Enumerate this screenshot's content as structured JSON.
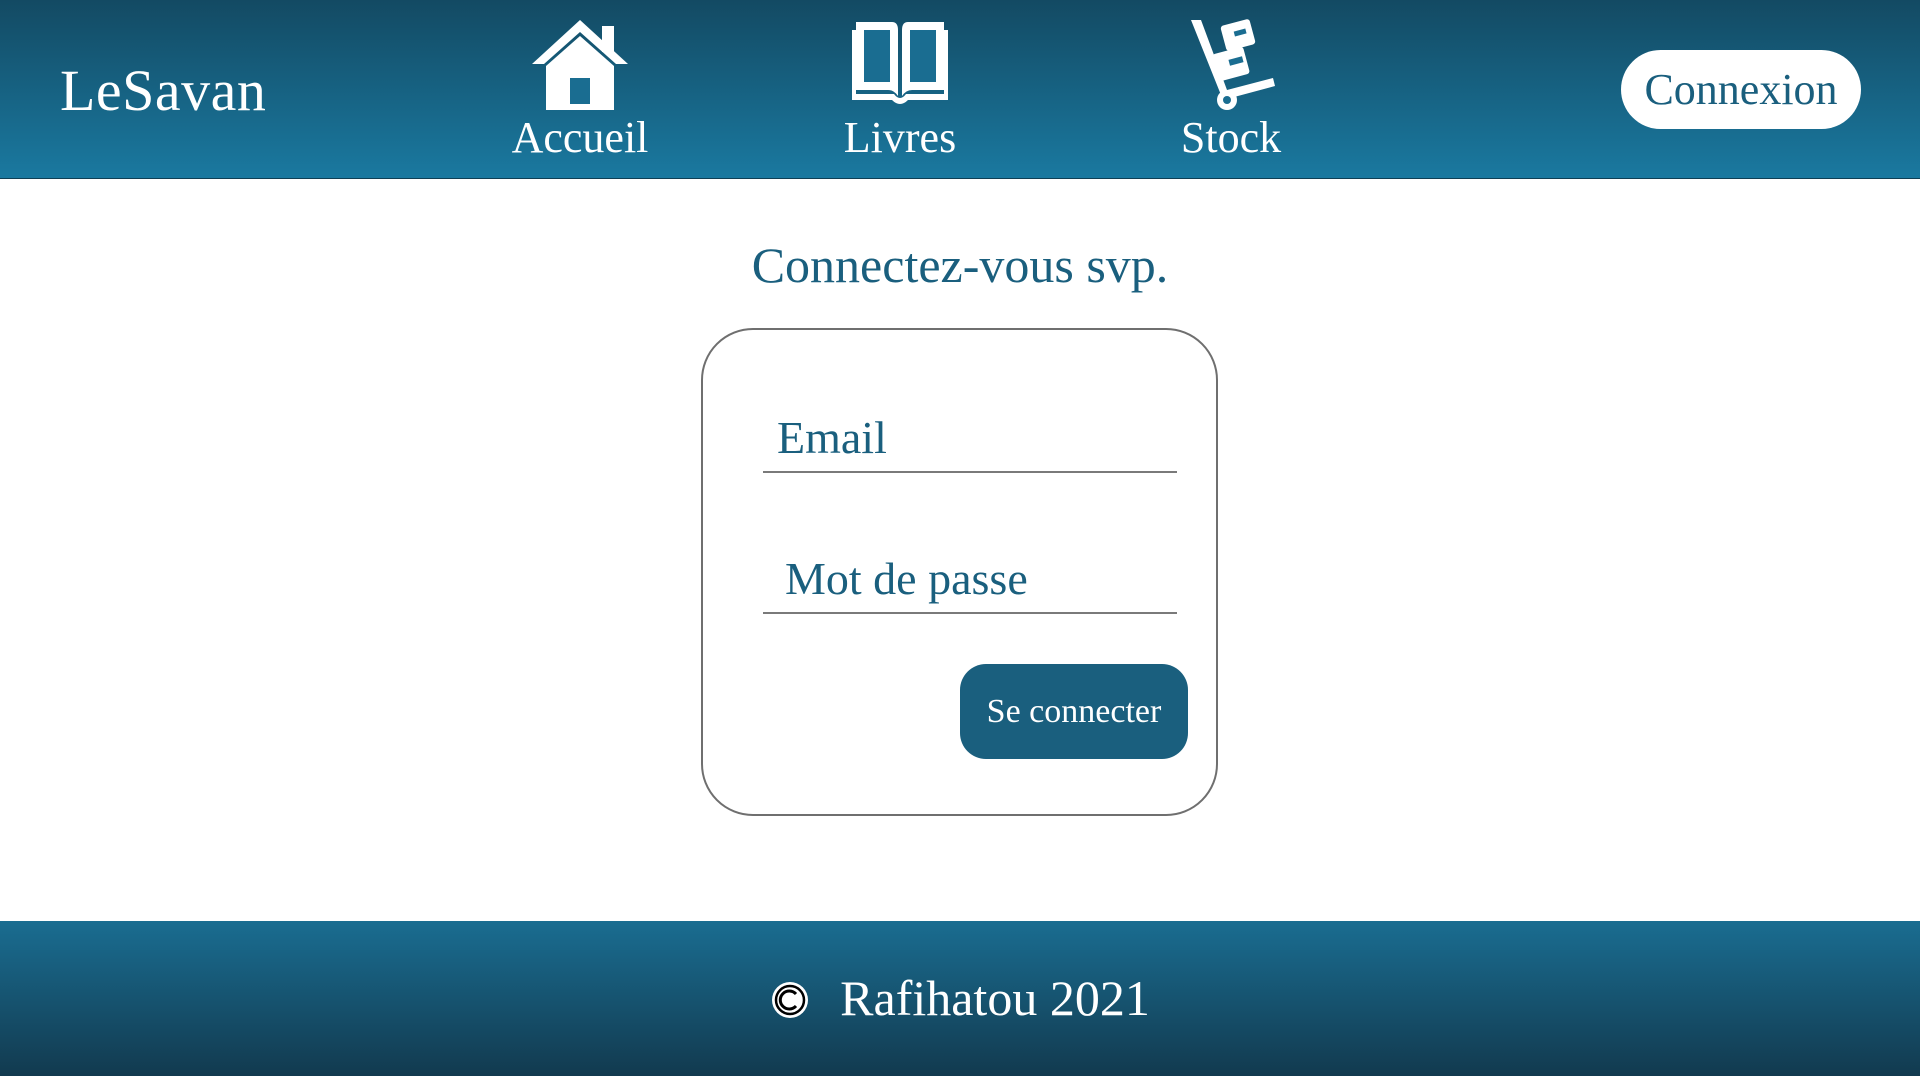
{
  "header": {
    "brand": "LeSavan",
    "nav": [
      {
        "label": "Accueil",
        "icon": "home-icon"
      },
      {
        "label": "Livres",
        "icon": "book-icon"
      },
      {
        "label": "Stock",
        "icon": "hand-truck-icon"
      }
    ],
    "connexion_label": "Connexion"
  },
  "main": {
    "title": "Connectez-vous svp.",
    "email_placeholder": "Email",
    "password_placeholder": "Mot de passe",
    "submit_label": "Se connecter"
  },
  "footer": {
    "icon": "copyright-icon",
    "text": "Rafihatou 2021"
  },
  "colors": {
    "header_dark": "#134a63",
    "header_light": "#1a79a0",
    "accent": "#1a5f7e",
    "footer_dark": "#123a4f"
  }
}
